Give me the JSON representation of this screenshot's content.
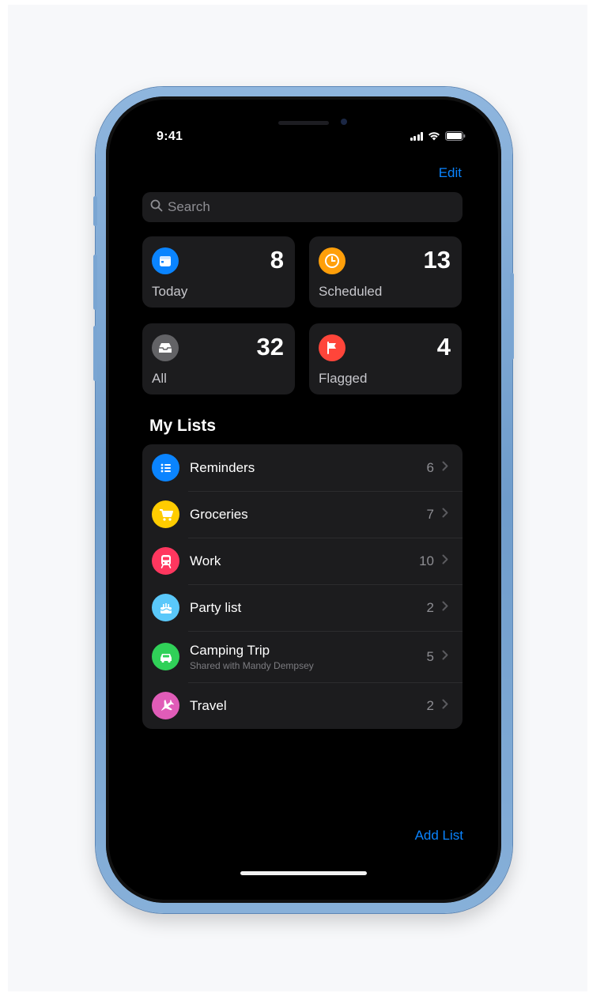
{
  "status_bar": {
    "time": "9:41"
  },
  "nav": {
    "edit_label": "Edit"
  },
  "search": {
    "placeholder": "Search"
  },
  "smart_lists": [
    {
      "label": "Today",
      "count": "8",
      "icon": "calendar-icon",
      "color": "#0a84ff"
    },
    {
      "label": "Scheduled",
      "count": "13",
      "icon": "clock-icon",
      "color": "#ff9f0a"
    },
    {
      "label": "All",
      "count": "32",
      "icon": "tray-icon",
      "color": "#636366"
    },
    {
      "label": "Flagged",
      "count": "4",
      "icon": "flag-icon",
      "color": "#ff453a"
    }
  ],
  "my_lists": {
    "title": "My Lists",
    "items": [
      {
        "name": "Reminders",
        "count": "6",
        "icon": "list-icon",
        "color": "#0a84ff"
      },
      {
        "name": "Groceries",
        "count": "7",
        "icon": "cart-icon",
        "color": "#ffcc00"
      },
      {
        "name": "Work",
        "count": "10",
        "icon": "train-icon",
        "color": "#ff375f"
      },
      {
        "name": "Party list",
        "count": "2",
        "icon": "cake-icon",
        "color": "#5ac8fa"
      },
      {
        "name": "Camping Trip",
        "subtitle": "Shared with Mandy Dempsey",
        "count": "5",
        "icon": "car-icon",
        "color": "#30d158"
      },
      {
        "name": "Travel",
        "count": "2",
        "icon": "airplane-icon",
        "color": "#e05cb8"
      }
    ]
  },
  "footer": {
    "add_list_label": "Add List"
  }
}
